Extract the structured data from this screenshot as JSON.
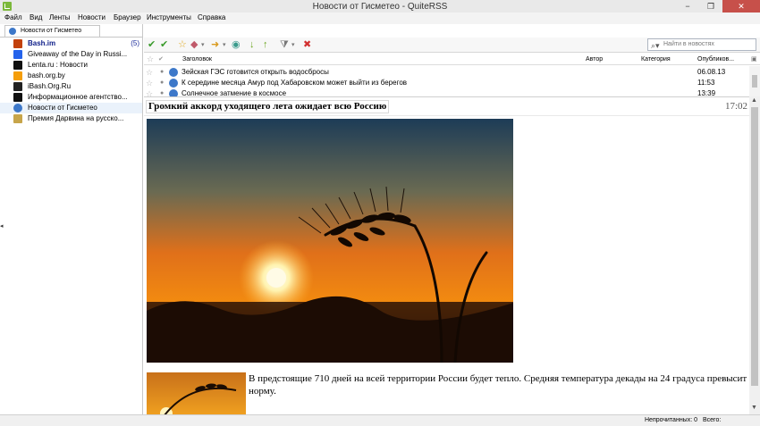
{
  "window": {
    "title": "Новости от Гисметео - QuiteRSS",
    "controls": {
      "minimize": "−",
      "maximize": "❐",
      "close": "✕"
    }
  },
  "menu": [
    "Файл",
    "Вид",
    "Ленты",
    "Новости",
    "Браузер",
    "Инструменты",
    "Справка"
  ],
  "sidebar": {
    "tab_label": "Новости от Гисметео",
    "feeds": [
      {
        "label": "Bash.im",
        "count": "(5)",
        "bold": true,
        "icon": "bash-icon",
        "color": "#c2410c"
      },
      {
        "label": "Giveaway of the Day in Russi...",
        "icon": "giveaway-icon",
        "color": "#2563eb"
      },
      {
        "label": "Lenta.ru : Новости",
        "icon": "lenta-icon",
        "color": "#111111"
      },
      {
        "label": "bash.org.by",
        "icon": "rss-icon",
        "color": "#f59e0b"
      },
      {
        "label": "iBash.Org.Ru",
        "icon": "ibash-icon",
        "color": "#222222"
      },
      {
        "label": "Информационное агентство...",
        "icon": "agency-icon",
        "color": "#111111"
      },
      {
        "label": "Новости от Гисметео",
        "icon": "gismeteo-icon",
        "color": "#3d78c9",
        "selected": true
      },
      {
        "label": "Премия Дарвина на русско...",
        "icon": "darwin-icon",
        "color": "#c7a54a"
      }
    ]
  },
  "toolbar": {
    "icons": [
      "mark-read-icon",
      "mark-all-read-icon",
      "star-icon",
      "label-icon",
      "share-icon",
      "browser-icon",
      "next-down-icon",
      "previous-up-icon",
      "filter-icon",
      "delete-icon"
    ],
    "search_placeholder": "Найти в новостях"
  },
  "list": {
    "columns": {
      "title": "Заголовок",
      "author": "Автор",
      "category": "Категория",
      "published": "Опубликов..."
    },
    "rows": [
      {
        "title": "Зейская ГЭС готовится открыть водосбросы",
        "date": "06.08.13"
      },
      {
        "title": "К середине месяца Амур под Хабаровском может выйти из берегов",
        "date": "11:53"
      },
      {
        "title": "Солнечное затмение в космосе",
        "date": "13:39"
      }
    ]
  },
  "article": {
    "title": "Громкий аккорд уходящего лета ожидает всю Россию",
    "time": "17:02",
    "text": "В предстоящие 710 дней на всей территории России будет тепло. Средняя температура декады на 24 градуса превысит норму."
  },
  "status": {
    "unread": "Непрочитанных: 0",
    "total": "Всего:"
  },
  "colors": {
    "accent": "#3d78c9",
    "selected_row": "#eaf2fb",
    "close_button": "#c7504a"
  }
}
